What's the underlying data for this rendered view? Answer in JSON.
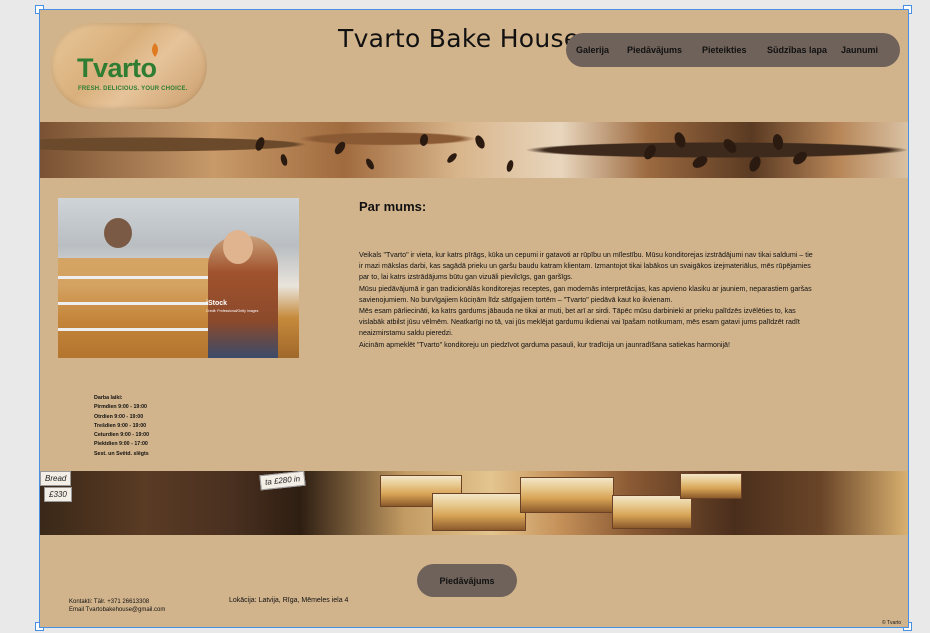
{
  "header": {
    "site_title": "Tvarto Bake House",
    "logo": {
      "brand": "Tvarto",
      "tagline": "FRESH. DELICIOUS. YOUR CHOICE."
    },
    "nav": [
      "Galerija",
      "Piedāvājums",
      "Pieteikties",
      "Sūdzības lapa",
      "Jaunumi"
    ]
  },
  "about": {
    "heading": "Par mums:",
    "image_watermark": "iStock",
    "image_credit": "Credit: Professional/Getty Images",
    "paragraphs": [
      "Veikals \"Tvarto\" ir vieta, kur katrs pīrāgs, kūka un cepumi ir gatavoti ar rūpību un mīlestību. Mūsu konditorejas izstrādājumi nav tikai saldumi – tie ir mazi mākslas darbi, kas sagādā prieku un garšu baudu katram klientam. Izmantojot tikai labākos un svaigākos izejmateriālus, mēs rūpējamies par to, lai katrs izstrādājums būtu gan vizuāli pievilcīgs, gan garšīgs.",
      "Mūsu piedāvājumā ir gan tradicionālās konditorejas receptes, gan modernās interpretācijas, kas apvieno klasiku ar jauniem, neparastiem garšas savienojumiem. No burvīgajiem kūciņām līdz sātīgajiem tortēm – \"Tvarto\" piedāvā kaut ko ikvienam.",
      "Mēs esam pārliecināti, ka katrs gardums jābauda ne tikai ar muti, bet arī ar sirdi. Tāpēc mūsu darbinieki ar prieku palīdzēs izvēlēties to, kas vislabāk atbilst jūsu vēlmēm. Neatkarīgi no tā, vai jūs meklējat gardumu ikdienai vai īpašam notikumam, mēs esam gatavi jums palīdzēt radīt neaizmirstamu saldu pieredzi.",
      "Aicinām apmeklēt \"Tvarto\" konditoreju un piedzīvot garduma pasauli, kur tradīcija un jaunradīšana satiekas harmonijā!"
    ]
  },
  "hours": {
    "title": "Darba laiki:",
    "lines": [
      "Pirmdien 9:00 - 19:00",
      "Otrdien 9:00 - 19:00",
      "Trešdien 9:00 - 19:00",
      "Ceturdien 9:00 - 19:00",
      "Piektdien 9:00 - 17:00",
      "Sest. un Svētd. slēgts"
    ]
  },
  "bottom_banner": {
    "tags": [
      "Bread",
      "ta £280 in",
      "£330"
    ]
  },
  "cta": {
    "label": "Piedāvājums"
  },
  "footer": {
    "contact_phone": "Kontakti: Tālr. +371 26613308",
    "contact_email": "Email Tvartobakehouse@gmail.com",
    "location": "Lokācija: Latvija, Rīga, Mēmeles iela 4",
    "copyright": "© Tvarto"
  },
  "colors": {
    "background": "#d2b48c",
    "nav_pill": "#6f625a",
    "brand_green": "#2e7d32",
    "selection": "#4a90e2"
  }
}
